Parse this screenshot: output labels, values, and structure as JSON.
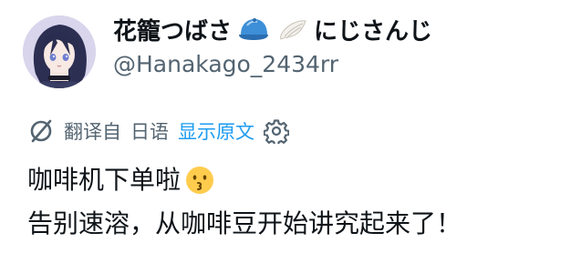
{
  "author": {
    "display_name": "花籠つばさ",
    "name_suffix": "にじさんじ",
    "handle": "@Hanakago_2434rr",
    "badges": [
      "blue-cap-icon",
      "white-wing-icon"
    ]
  },
  "translation": {
    "source_label": "翻译自",
    "language": "日语",
    "show_original_label": "显示原文",
    "icons": [
      "translate-icon",
      "settings-gear-icon"
    ]
  },
  "post": {
    "line1": "咖啡机下单啦",
    "line1_emoji": "kissing-face-emoji",
    "line2": "告别速溶，从咖啡豆开始讲究起来了！"
  },
  "colors": {
    "text": "#0f1419",
    "muted": "#536471",
    "link": "#1d9bf0",
    "cap": "#3d8fd8"
  }
}
